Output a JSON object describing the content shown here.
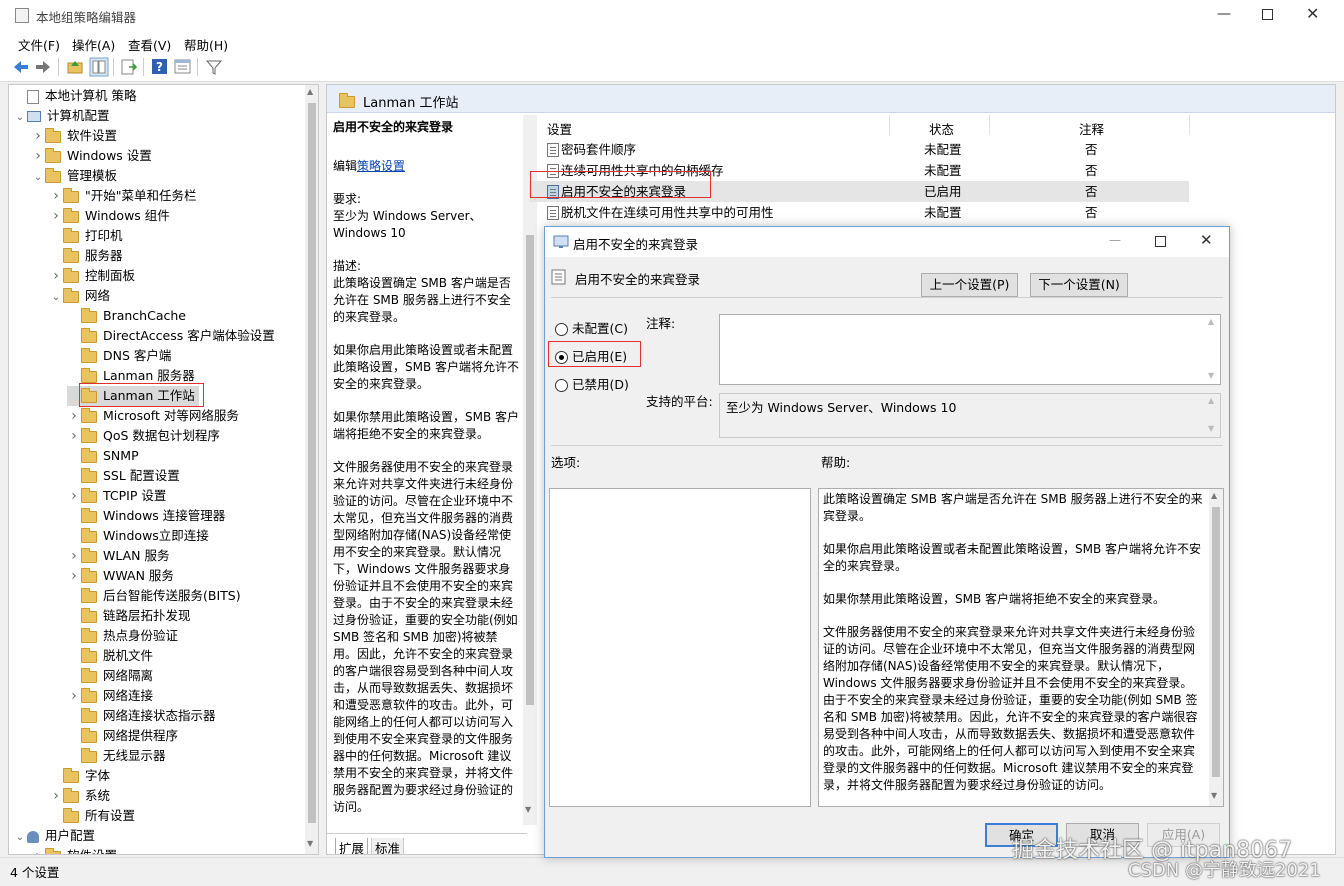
{
  "window": {
    "title": "本地组策略编辑器"
  },
  "menu": [
    "文件(F)",
    "操作(A)",
    "查看(V)",
    "帮助(H)"
  ],
  "tree": {
    "items": [
      {
        "label": "本地计算机 策略"
      },
      {
        "label": "计算机配置"
      },
      {
        "label": "软件设置"
      },
      {
        "label": "Windows 设置"
      },
      {
        "label": "管理模板"
      },
      {
        "label": "\"开始\"菜单和任务栏"
      },
      {
        "label": "Windows 组件"
      },
      {
        "label": "打印机"
      },
      {
        "label": "服务器"
      },
      {
        "label": "控制面板"
      },
      {
        "label": "网络"
      },
      {
        "label": "BranchCache"
      },
      {
        "label": "DirectAccess 客户端体验设置"
      },
      {
        "label": "DNS 客户端"
      },
      {
        "label": "Lanman 服务器"
      },
      {
        "label": "Lanman 工作站"
      },
      {
        "label": "Microsoft 对等网络服务"
      },
      {
        "label": "QoS 数据包计划程序"
      },
      {
        "label": "SNMP"
      },
      {
        "label": "SSL 配置设置"
      },
      {
        "label": "TCPIP 设置"
      },
      {
        "label": "Windows 连接管理器"
      },
      {
        "label": "Windows立即连接"
      },
      {
        "label": "WLAN 服务"
      },
      {
        "label": "WWAN 服务"
      },
      {
        "label": "后台智能传送服务(BITS)"
      },
      {
        "label": "链路层拓扑发现"
      },
      {
        "label": "热点身份验证"
      },
      {
        "label": "脱机文件"
      },
      {
        "label": "网络隔离"
      },
      {
        "label": "网络连接"
      },
      {
        "label": "网络连接状态指示器"
      },
      {
        "label": "网络提供程序"
      },
      {
        "label": "无线显示器"
      },
      {
        "label": "字体"
      },
      {
        "label": "系统"
      },
      {
        "label": "所有设置"
      },
      {
        "label": "用户配置"
      },
      {
        "label": "软件设置"
      }
    ]
  },
  "panel": {
    "header": "Lanman 工作站",
    "desc_title": "启用不安全的来宾登录",
    "edit_prefix": "编辑",
    "edit_link": "策略设置",
    "requirements_label": "要求:",
    "requirements": "至少为 Windows Server、Windows 10",
    "desc_label": "描述:",
    "desc_p1": "此策略设置确定 SMB 客户端是否允许在 SMB 服务器上进行不安全的来宾登录。",
    "desc_p2": "如果你启用此策略设置或者未配置此策略设置，SMB 客户端将允许不安全的来宾登录。",
    "desc_p3": "如果你禁用此策略设置，SMB 客户端将拒绝不安全的来宾登录。",
    "desc_p4": "文件服务器使用不安全的来宾登录来允许对共享文件夹进行未经身份验证的访问。尽管在企业环境中不太常见，但充当文件服务器的消费型网络附加存储(NAS)设备经常使用不安全的来宾登录。默认情况下，Windows 文件服务器要求身份验证并且不会使用不安全的来宾登录。由于不安全的来宾登录未经过身份验证，重要的安全功能(例如 SMB 签名和 SMB 加密)将被禁用。因此，允许不安全的来宾登录的客户端很容易受到各种中间人攻击，从而导致数据丢失、数据损坏和遭受恶意软件的攻击。此外，可能网络上的任何人都可以访问写入到使用不安全来宾登录的文件服务器中的任何数据。Microsoft 建议禁用不安全的来宾登录，并将文件服务器配置为要求经过身份验证的访问。",
    "tabs": [
      "扩展",
      "标准"
    ]
  },
  "list": {
    "columns": [
      "设置",
      "状态",
      "注释"
    ],
    "rows": [
      {
        "name": "密码套件顺序",
        "state": "未配置",
        "note": "否"
      },
      {
        "name": "连续可用性共享中的句柄缓存",
        "state": "未配置",
        "note": "否"
      },
      {
        "name": "启用不安全的来宾登录",
        "state": "已启用",
        "note": "否"
      },
      {
        "name": "脱机文件在连续可用性共享中的可用性",
        "state": "未配置",
        "note": "否"
      }
    ]
  },
  "dialog": {
    "title": "启用不安全的来宾登录",
    "policy_name": "启用不安全的来宾登录",
    "prev_button": "上一个设置(P)",
    "next_button": "下一个设置(N)",
    "radio_not_configured": "未配置(C)",
    "radio_enabled": "已启用(E)",
    "radio_disabled": "已禁用(D)",
    "comment_label": "注释:",
    "platform_label": "支持的平台:",
    "platform_value": "至少为 Windows Server、Windows 10",
    "options_label": "选项:",
    "help_label": "帮助:",
    "help_p1": "此策略设置确定 SMB 客户端是否允许在 SMB 服务器上进行不安全的来宾登录。",
    "help_p2": "如果你启用此策略设置或者未配置此策略设置，SMB 客户端将允许不安全的来宾登录。",
    "help_p3": "如果你禁用此策略设置，SMB 客户端将拒绝不安全的来宾登录。",
    "help_p4": "文件服务器使用不安全的来宾登录来允许对共享文件夹进行未经身份验证的访问。尽管在企业环境中不太常见，但充当文件服务器的消费型网络附加存储(NAS)设备经常使用不安全的来宾登录。默认情况下，Windows 文件服务器要求身份验证并且不会使用不安全的来宾登录。由于不安全的来宾登录未经过身份验证，重要的安全功能(例如 SMB 签名和 SMB 加密)将被禁用。因此，允许不安全的来宾登录的客户端很容易受到各种中间人攻击，从而导致数据丢失、数据损坏和遭受恶意软件的攻击。此外，可能网络上的任何人都可以访问写入到使用不安全来宾登录的文件服务器中的任何数据。Microsoft 建议禁用不安全的来宾登录，并将文件服务器配置为要求经过身份验证的访问。",
    "ok_button": "确定",
    "cancel_button": "取消",
    "apply_button": "应用(A)"
  },
  "statusbar": {
    "text": "4 个设置"
  },
  "watermark": {
    "line1": "掘金技术社区 @ itpan8067",
    "line2": "CSDN @宁静致远2021"
  }
}
